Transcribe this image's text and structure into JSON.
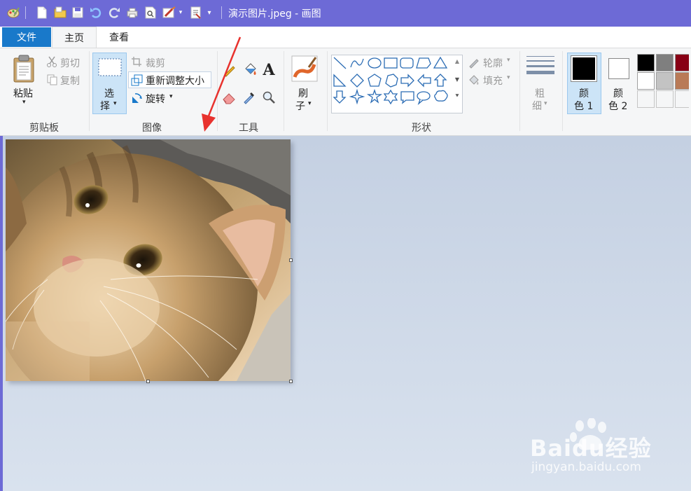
{
  "window": {
    "title": "演示图片.jpeg - 画图"
  },
  "tabs": {
    "file": "文件",
    "home": "主页",
    "view": "查看"
  },
  "clipboard": {
    "paste": "粘贴",
    "cut": "剪切",
    "copy": "复制",
    "group_label": "剪贴板"
  },
  "image": {
    "select_line1": "选",
    "select_line2": "择",
    "crop": "裁剪",
    "resize": "重新调整大小",
    "rotate": "旋转",
    "group_label": "图像"
  },
  "tools": {
    "group_label": "工具"
  },
  "brushes": {
    "line1": "刷",
    "line2": "子"
  },
  "shapes": {
    "outline": "轮廓",
    "fill": "填充",
    "group_label": "形状"
  },
  "size": {
    "line1": "粗",
    "line2": "细"
  },
  "colors": {
    "color1_line1": "颜",
    "color1_line2": "色 1",
    "color2_line1": "颜",
    "color2_line2": "色 2",
    "color1_value": "#000000",
    "color2_value": "#ffffff",
    "palette": [
      "#000000",
      "#7f7f7f",
      "#880015",
      "#ffffff",
      "#c3c3c3",
      "#b97a57",
      "#f5f6f7",
      "#f5f6f7",
      "#f5f6f7"
    ]
  },
  "watermark": {
    "brand": "Baidu经验",
    "url": "jingyan.baidu.com"
  },
  "theme": {
    "titlebar": "#6d6ad6",
    "file_tab": "#1979ca",
    "arrow": "#e8322e"
  }
}
